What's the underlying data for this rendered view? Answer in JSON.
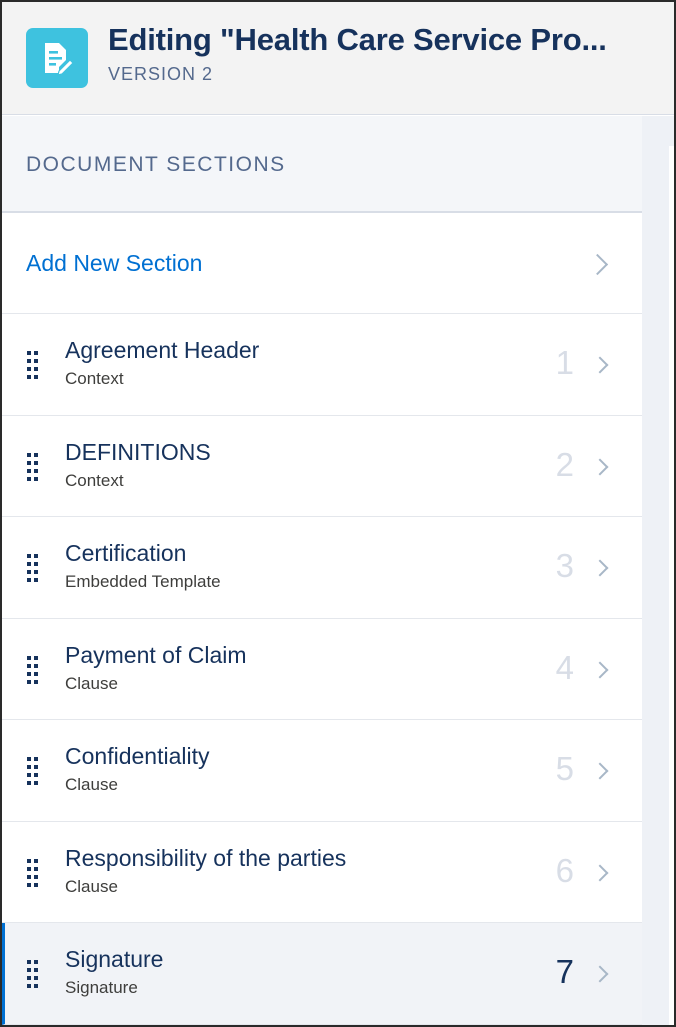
{
  "header": {
    "title": "Editing \"Health Care Service Pro...",
    "version": "VERSION 2",
    "icon": "document-edit-icon",
    "icon_color": "#3ec2df"
  },
  "sidebar": {
    "heading": "DOCUMENT SECTIONS",
    "add_label": "Add New Section",
    "accent_color": "#0070d2",
    "sections": [
      {
        "title": "Agreement Header",
        "type": "Context",
        "number": "1",
        "selected": false
      },
      {
        "title": "DEFINITIONS",
        "type": "Context",
        "number": "2",
        "selected": false
      },
      {
        "title": "Certification",
        "type": "Embedded Template",
        "number": "3",
        "selected": false
      },
      {
        "title": "Payment of Claim",
        "type": "Clause",
        "number": "4",
        "selected": false
      },
      {
        "title": "Confidentiality",
        "type": "Clause",
        "number": "5",
        "selected": false
      },
      {
        "title": "Responsibility of the parties",
        "type": "Clause",
        "number": "6",
        "selected": false
      },
      {
        "title": "Signature",
        "type": "Signature",
        "number": "7",
        "selected": true
      }
    ]
  }
}
